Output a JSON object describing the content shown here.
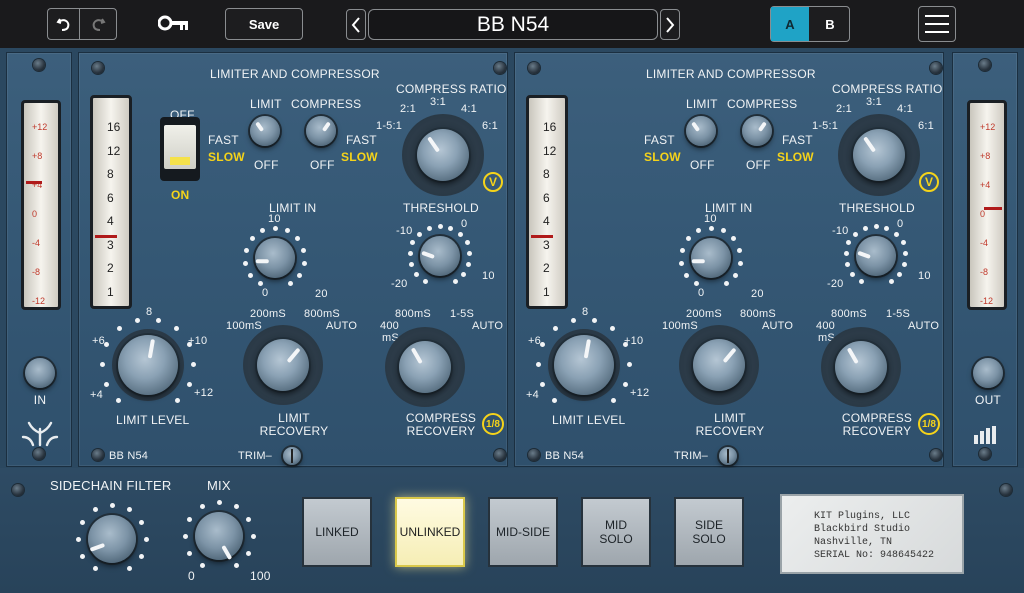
{
  "toolbar": {
    "undo_icon": "undo-icon",
    "redo_icon": "redo-icon",
    "key_icon": "key-icon",
    "save_label": "Save",
    "prev_icon": "chevron-left-icon",
    "next_icon": "chevron-right-icon",
    "preset_name": "BB N54",
    "a_label": "A",
    "b_label": "B",
    "menu_icon": "hamburger-menu-icon",
    "accent_color": "#1fa3c6"
  },
  "channel_left": {
    "title": "LIMITER AND COMPRESSOR",
    "off_label": "OFF",
    "on_label": "ON",
    "limit_label": "LIMIT",
    "compress_label": "COMPRESS",
    "fast_label": "FAST",
    "slow_label": "SLOW",
    "off_small": "OFF",
    "compress_ratio_label": "COMPRESS RATIO",
    "ratio_ticks": [
      "1-5:1",
      "2:1",
      "3:1",
      "4:1",
      "6:1"
    ],
    "v_badge": "V",
    "limit_in_label": "LIMIT IN",
    "limit_in_ticks": [
      "10",
      "0",
      "20"
    ],
    "threshold_label": "THRESHOLD",
    "threshold_ticks": [
      "-10",
      "0",
      "-20",
      "10"
    ],
    "limit_recovery_ticks": [
      "200mS",
      "800mS",
      "100mS",
      "AUTO"
    ],
    "compress_recovery_ticks": [
      "800mS",
      "1-5S",
      "400",
      "mS",
      "AUTO"
    ],
    "limit_level_label": "LIMIT LEVEL",
    "limit_level_ticks": [
      "8",
      "+6",
      "+10",
      "+4",
      "+12"
    ],
    "limit_recovery_label": "LIMIT\nRECOVERY",
    "compress_recovery_label": "COMPRESS\nRECOVERY",
    "fraction_badge": "1/8",
    "trim_label": "TRIM–",
    "model_label": "BB N54",
    "meter_scale": [
      "16",
      "12",
      "8",
      "6",
      "4",
      "3",
      "2",
      "1"
    ]
  },
  "channel_right": {
    "title": "LIMITER AND COMPRESSOR",
    "limit_label": "LIMIT",
    "compress_label": "COMPRESS",
    "fast_label": "FAST",
    "slow_label": "SLOW",
    "off_small": "OFF",
    "compress_ratio_label": "COMPRESS RATIO",
    "ratio_ticks": [
      "1-5:1",
      "2:1",
      "3:1",
      "4:1",
      "6:1"
    ],
    "v_badge": "V",
    "limit_in_label": "LIMIT IN",
    "limit_in_ticks": [
      "10",
      "0",
      "20"
    ],
    "threshold_label": "THRESHOLD",
    "threshold_ticks": [
      "-10",
      "0",
      "-20",
      "10"
    ],
    "limit_recovery_ticks": [
      "200mS",
      "800mS",
      "100mS",
      "AUTO"
    ],
    "compress_recovery_ticks": [
      "800mS",
      "1-5S",
      "400",
      "mS",
      "AUTO"
    ],
    "limit_level_label": "LIMIT LEVEL",
    "limit_level_ticks": [
      "8",
      "+6",
      "+10",
      "+4",
      "+12"
    ],
    "limit_recovery_label": "LIMIT\nRECOVERY",
    "compress_recovery_label": "COMPRESS\nRECOVERY",
    "fraction_badge": "1/8",
    "trim_label": "TRIM–",
    "model_label": "BB N54",
    "meter_scale": [
      "16",
      "12",
      "8",
      "6",
      "4",
      "3",
      "2",
      "1"
    ]
  },
  "input_meter": {
    "scale": [
      "+12",
      "+8",
      "+4",
      "0",
      "-4",
      "-8",
      "-12"
    ],
    "label": "IN",
    "logo_icon": "trident-logo-icon"
  },
  "output_meter": {
    "scale": [
      "+12",
      "+8",
      "+4",
      "0",
      "-4",
      "-8",
      "-12"
    ],
    "label": "OUT",
    "logo_icon": "bars-logo-icon"
  },
  "sidechain": {
    "label": "SIDECHAIN FILTER",
    "mix_label": "MIX",
    "mix_min": "0",
    "mix_max": "100"
  },
  "modes": [
    {
      "label": "LINKED",
      "active": false
    },
    {
      "label": "UNLINKED",
      "active": true
    },
    {
      "label": "MID-SIDE",
      "active": false
    },
    {
      "label": "MID\nSOLO",
      "active": false
    },
    {
      "label": "SIDE\nSOLO",
      "active": false
    }
  ],
  "serial_plate": {
    "line1": "KIT Plugins, LLC",
    "line2": "Blackbird Studio",
    "line3": "Nashville, TN",
    "line4": "SERIAL No: 948645422"
  }
}
